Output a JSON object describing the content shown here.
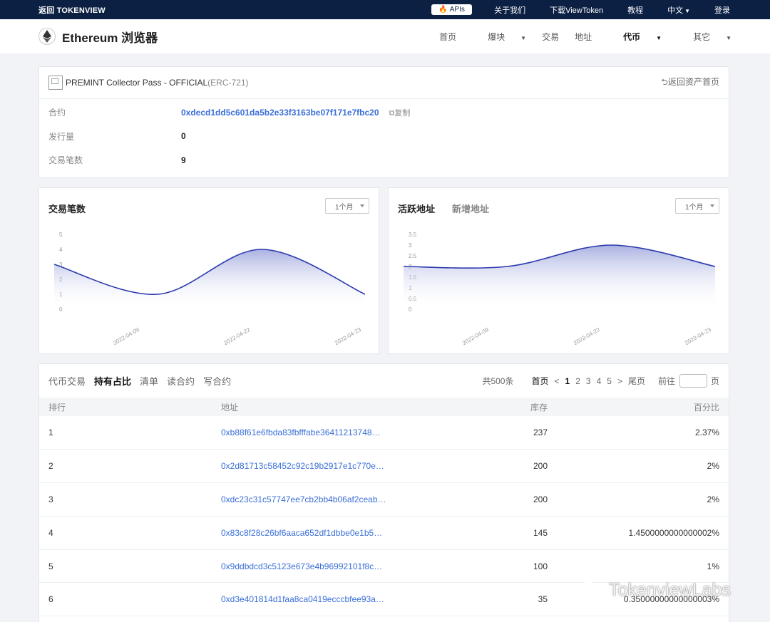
{
  "topbar": {
    "back": "返回 TOKENVIEW",
    "apis": "APIs",
    "links": [
      "关于我们",
      "下载ViewToken",
      "教程",
      "中文",
      "登录"
    ]
  },
  "navbar": {
    "brand": "Ethereum 浏览器",
    "items": [
      "首页",
      "爆块",
      "交易",
      "地址",
      "代币",
      "其它"
    ]
  },
  "token": {
    "name": "PREMINT Collector Pass - OFFICIAL",
    "standard": "(ERC-721)",
    "back_label": "返回资产首页",
    "rows": [
      {
        "label": "合约",
        "value": "0xdecd1dd5c601da5b2e33f3163be07f171e7fbc20"
      },
      {
        "label": "发行量",
        "value": "0"
      },
      {
        "label": "交易笔数",
        "value": "9"
      }
    ],
    "copy_label": "复制"
  },
  "charts": {
    "tx": {
      "title": "交易笔数",
      "select": "1个月"
    },
    "addr": {
      "title": "活跃地址",
      "title2": "新增地址",
      "select": "1个月"
    }
  },
  "chart_data": [
    {
      "type": "area",
      "x": [
        "2022-04-09",
        "2022-04-22",
        "2022-04-23"
      ],
      "ylim": [
        0,
        5
      ],
      "yticks": [
        "5",
        "4",
        "3",
        "2",
        "1",
        "0"
      ],
      "xticklabels": [
        "2022-04-09",
        "2022-04-22",
        "2022-04-23"
      ],
      "values": [
        3,
        1,
        4,
        1
      ],
      "color": "#2b3aad"
    },
    {
      "type": "area",
      "x": [
        "2022-04-09",
        "2022-04-22",
        "2022-04-23"
      ],
      "ylim": [
        0,
        3.5
      ],
      "yticks": [
        "3.5",
        "3",
        "2.5",
        "2",
        "1.5",
        "1",
        "0.5",
        "0"
      ],
      "xticklabels": [
        "2022-04-09",
        "2022-04-22",
        "2022-04-23"
      ],
      "values": [
        2,
        2,
        3,
        2
      ],
      "color": "#2b3aad"
    }
  ],
  "holders": {
    "tabs": [
      "代币交易",
      "持有占比",
      "清单",
      "读合约",
      "写合约"
    ],
    "active_tab": 1,
    "pager": {
      "total": "共500条",
      "first": "首页",
      "prev": "<",
      "pages": [
        "1",
        "2",
        "3",
        "4",
        "5"
      ],
      "next": ">",
      "last": "尾页",
      "goto": "前往",
      "page_unit": "页"
    },
    "columns": [
      "排行",
      "地址",
      "库存",
      "百分比"
    ],
    "rows": [
      {
        "rank": "1",
        "address": "0xb88f61e6fbda83fbfffabe36411213748…",
        "balance": "237",
        "pct": "2.37%"
      },
      {
        "rank": "2",
        "address": "0x2d81713c58452c92c19b2917e1c770e…",
        "balance": "200",
        "pct": "2%"
      },
      {
        "rank": "3",
        "address": "0xdc23c31c57747ee7cb2bb4b06af2ceab…",
        "balance": "200",
        "pct": "2%"
      },
      {
        "rank": "4",
        "address": "0x83c8f28c26bf6aaca652df1dbbe0e1b5…",
        "balance": "145",
        "pct": "1.4500000000000002%"
      },
      {
        "rank": "5",
        "address": "0x9ddbdcd3c5123e673e4b96992101f8c…",
        "balance": "100",
        "pct": "1%"
      },
      {
        "rank": "6",
        "address": "0xd3e401814d1faa8ca0419ecccbfee93a…",
        "balance": "35",
        "pct": "0.35000000000000003%"
      }
    ]
  },
  "watermark": "TokenviewLabs"
}
